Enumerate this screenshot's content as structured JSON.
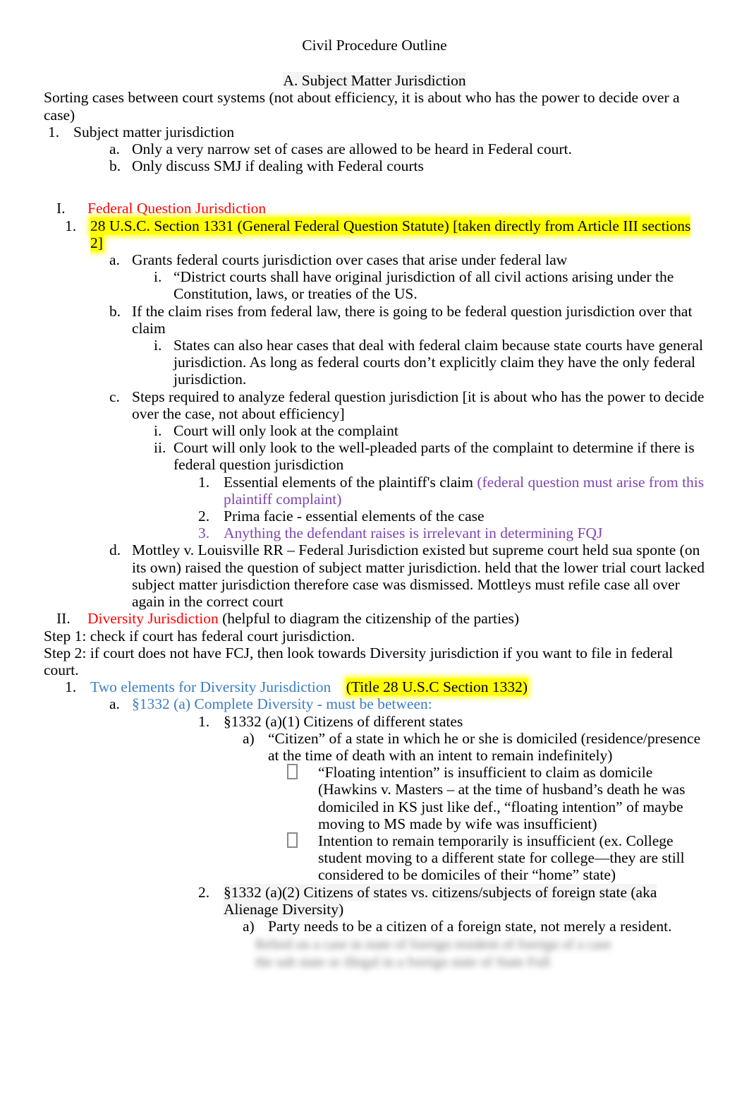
{
  "document": {
    "title": "Civil Procedure Outline",
    "section_heading": "A.  Subject Matter Jurisdiction",
    "intro": "Sorting cases between court systems (not about efficiency, it is about who has the power to decide over a case)"
  },
  "colors": {
    "red": "#FF0000",
    "purple": "#7E46AF",
    "blue": "#3B7DC4",
    "highlight_yellow": "#FFFF00",
    "body_black": "#000000"
  },
  "smj": {
    "marker": "1.",
    "text": "Subject matter jurisdiction",
    "sub": [
      {
        "marker": "a.",
        "text": "Only a very narrow set of cases are allowed to be heard in Federal court."
      },
      {
        "marker": "b.",
        "text": "Only discuss SMJ if dealing with Federal courts"
      }
    ]
  },
  "fqj": {
    "marker": "I.",
    "heading": "Federal Question Jurisdiction",
    "statute": {
      "marker": "1.",
      "text": "28 U.S.C. Section 1331 (General Federal Question Statute) [taken directly from Article III sections 2]"
    },
    "a": {
      "marker": "a.",
      "text": "Grants federal courts jurisdiction over cases that arise under federal law",
      "i": {
        "marker": "i.",
        "text": "“District courts shall have original jurisdiction of all civil actions arising under the Constitution, laws, or treaties of the US."
      }
    },
    "b": {
      "marker": "b.",
      "text": "If the claim rises from federal law, there is going to be federal question jurisdiction over that claim",
      "i": {
        "marker": "i.",
        "text": "States can also hear cases that deal with federal claim because state courts have general jurisdiction. As long as federal courts don’t explicitly claim they have the only federal jurisdiction."
      }
    },
    "c": {
      "marker": "c.",
      "text": "Steps required to analyze federal question jurisdiction [it is about who has the power to decide over the case, not about efficiency]",
      "i": {
        "marker": "i.",
        "text": "Court will only look at the complaint"
      },
      "ii": {
        "marker": "ii.",
        "text": "Court will only look to the well-pleaded parts   of the complaint to determine if there is federal question jurisdiction",
        "items": [
          {
            "marker": "1.",
            "black_text": "Essential elements of the plaintiff's claim ",
            "purple_text": "(federal question must arise from this plaintiff complaint)"
          },
          {
            "marker": "2.",
            "black_text": "Prima facie - essential elements of the case",
            "purple_text": ""
          },
          {
            "marker": "3.",
            "black_text": "",
            "purple_text": "Anything the defendant raises is irrelevant in determining FQJ"
          }
        ]
      }
    },
    "d": {
      "marker": "d.",
      "text": "Mottley v. Louisville RR – Federal Jurisdiction existed but supreme court held sua sponte (on its own) raised the question of subject matter jurisdiction. held that the lower trial court lacked subject matter jurisdiction therefore case was dismissed.  Mottleys must refile case all over again in the correct court"
    }
  },
  "diversity": {
    "marker": "II.",
    "heading": "Diversity Jurisdiction",
    "heading_tail": " (helpful to diagram the citizenship of the parties)",
    "step1": "Step 1: check if court has federal court jurisdiction.",
    "step2": "Step 2: if court does not have FCJ, then look towards Diversity jurisdiction if you want to file in federal court.",
    "two_elements": {
      "marker": "1.",
      "blue_text": "Two elements for Diversity Jurisdiction",
      "gap": "    ",
      "highlight_text": "(Title 28 U.S.C Section 1332)"
    },
    "complete_diversity": {
      "marker": "a.",
      "text": "§1332 (a) Complete Diversity - must be between:"
    },
    "a1": {
      "marker": "1.",
      "text": "§1332 (a)(1) Citizens of different states",
      "a": {
        "marker": "a)",
        "text": "“Citizen” of a state in which he or she is domiciled (residence/presence at the time of death with an intent to remain indefinitely)",
        "bullets": [
          {
            "icon": "tofu-box-bullet",
            "text": "“Floating intention” is insufficient to claim as domicile (Hawkins v. Masters – at the time of husband’s death he was domiciled in KS just like def., “floating intention” of maybe moving to MS made by wife was insufficient)"
          },
          {
            "icon": "tofu-box-bullet",
            "text": "Intention to remain temporarily is insufficient (ex. College student moving to a different state for college—they are still considered to be domiciles of their “home” state)"
          }
        ]
      }
    },
    "a2": {
      "marker": "2.",
      "text": "§1332 (a)(2) Citizens of states vs. citizens/subjects of foreign state (aka Alienage Diversity)",
      "a": {
        "marker": "a)",
        "text": "Party needs to be a citizen of a foreign state, not merely a resident."
      }
    },
    "redacted": {
      "note": "blurred-unreadable-text",
      "line1": "Relied on a case in state of foreign   resident of foreign of a case",
      "line2": "the sub state or illegal in a foreign state of State  Full"
    }
  }
}
